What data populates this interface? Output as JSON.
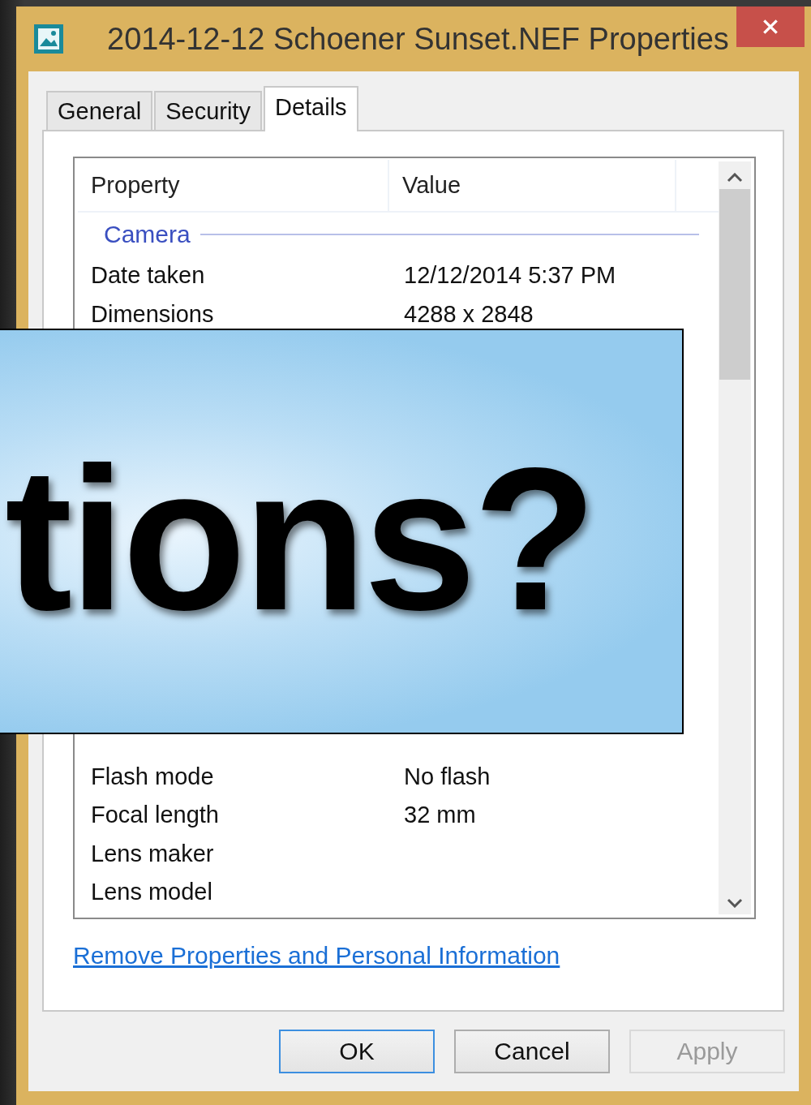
{
  "window": {
    "title": "2014-12-12 Schoener Sunset.NEF Properties"
  },
  "tabs": [
    {
      "label": "General",
      "selected": false
    },
    {
      "label": "Security",
      "selected": false
    },
    {
      "label": "Details",
      "selected": true
    }
  ],
  "table": {
    "columns": [
      "Property",
      "Value"
    ],
    "group": "Camera",
    "rows_above_banner": [
      {
        "property": "Date taken",
        "value": "12/12/2014 5:37 PM"
      },
      {
        "property": "Dimensions",
        "value": "4288 x 2848"
      }
    ],
    "rows_below_banner": [
      {
        "property": "Flash mode",
        "value": "No flash"
      },
      {
        "property": "Focal length",
        "value": "32 mm"
      },
      {
        "property": "Lens maker"
      },
      {
        "property": "Lens model"
      }
    ]
  },
  "link": "Remove Properties and Personal Information",
  "buttons": [
    {
      "label": "OK",
      "default": true,
      "disabled": false
    },
    {
      "label": "Cancel",
      "default": false,
      "disabled": false
    },
    {
      "label": "Apply",
      "default": false,
      "disabled": true
    }
  ],
  "banner": {
    "text": "tions?"
  }
}
